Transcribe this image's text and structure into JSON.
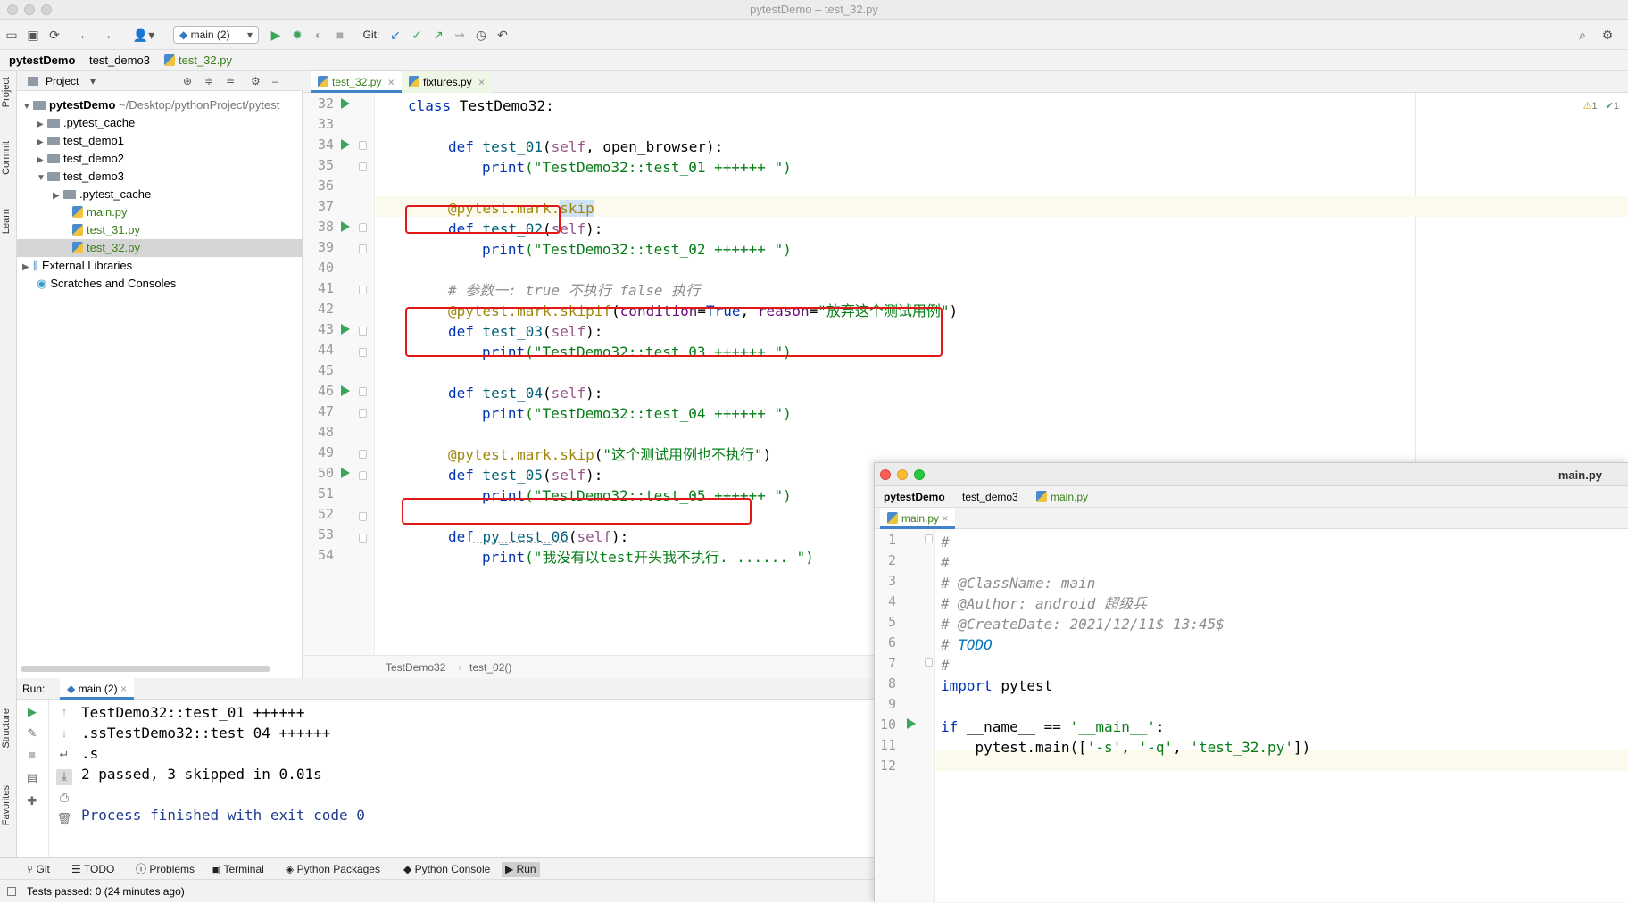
{
  "window": {
    "title": "pytestDemo – test_32.py"
  },
  "toolbar": {
    "run_config": "main (2)",
    "git_label": "Git:"
  },
  "breadcrumb": [
    "pytestDemo",
    "test_demo3",
    "test_32.py"
  ],
  "left_strip": [
    "Project",
    "Commit",
    "Learn",
    "Structure",
    "Favorites"
  ],
  "project_panel": {
    "header": "Project",
    "root_name": "pytestDemo",
    "root_path": "~/Desktop/pythonProject/pytest",
    "items": [
      {
        "label": ".pytest_cache",
        "type": "folder",
        "depth": 1
      },
      {
        "label": "test_demo1",
        "type": "folder",
        "depth": 1
      },
      {
        "label": "test_demo2",
        "type": "folder",
        "depth": 1
      },
      {
        "label": "test_demo3",
        "type": "folder",
        "depth": 1
      },
      {
        "label": ".pytest_cache",
        "type": "folder",
        "depth": 2
      },
      {
        "label": "main.py",
        "type": "py",
        "depth": 2
      },
      {
        "label": "test_31.py",
        "type": "py",
        "depth": 2
      },
      {
        "label": "test_32.py",
        "type": "py",
        "depth": 2
      },
      {
        "label": "External Libraries",
        "type": "lib",
        "depth": 0
      },
      {
        "label": "Scratches and Consoles",
        "type": "scratch",
        "depth": 0
      }
    ]
  },
  "editor": {
    "tabs": [
      "test_32.py",
      "fixtures.py"
    ],
    "inspections": {
      "warnings": "1",
      "ok": "1"
    },
    "line_numbers": [
      "32",
      "33",
      "34",
      "35",
      "36",
      "37",
      "38",
      "39",
      "40",
      "41",
      "42",
      "43",
      "44",
      "45",
      "46",
      "47",
      "48",
      "49",
      "50",
      "51",
      "52",
      "53",
      "54"
    ],
    "lines": {
      "l32_kw": "class",
      "l32_name": " TestDemo32:",
      "l34_def": "def",
      "l34_fn": " test_01",
      "l34_a": "(",
      "l34_self": "self",
      "l34_b": ", open_browser):",
      "l35_print": "print",
      "l35_str": "(\"TestDemo32::test_01 ++++++ \")",
      "l37_dec": "@pytest.mark.",
      "l37_skip": "skip",
      "l38_def": "def",
      "l38_fn": " test_02",
      "l38_a": "(",
      "l38_self": "self",
      "l38_b": "):",
      "l39_print": "print",
      "l39_str": "(\"TestDemo32::test_02 ++++++ \")",
      "l41_cmt": "# 参数一: true 不执行 false 执行",
      "l42_dec": "@pytest.mark.skipif",
      "l42_a": "(",
      "l42_p1": "condition",
      "l42_b": "=",
      "l42_true": "True",
      "l42_c": ", ",
      "l42_p2": "reason",
      "l42_d": "=",
      "l42_str": "\"放弃这个测试用例\"",
      "l42_e": ")",
      "l43_def": "def",
      "l43_fn": " test_03",
      "l43_a": "(",
      "l43_self": "self",
      "l43_b": "):",
      "l44_print": "print",
      "l44_str": "(\"TestDemo32::test_03 ++++++ \")",
      "l46_def": "def",
      "l46_fn": " test_04",
      "l46_a": "(",
      "l46_self": "self",
      "l46_b": "):",
      "l47_print": "print",
      "l47_str": "(\"TestDemo32::test_04 ++++++ \")",
      "l49_dec": "@pytest.mark.skip",
      "l49_a": "(",
      "l49_str": "\"这个测试用例也不执行\"",
      "l49_b": ")",
      "l50_def": "def",
      "l50_fn": " test_05",
      "l50_a": "(",
      "l50_self": "self",
      "l50_b": "):",
      "l51_print": "print",
      "l51_str": "(\"TestDemo32::test_05 ++++++ \")",
      "l53_def": "def",
      "l53_fn": " py_test_06",
      "l53_a": "(",
      "l53_self": "self",
      "l53_b": "):",
      "l54_print": "print",
      "l54_str": "(\"我没有以test开头我不执行. ...... \")"
    },
    "crumb": [
      "TestDemo32",
      "test_02()"
    ]
  },
  "run_panel": {
    "label": "Run:",
    "tab": "main (2)",
    "output": [
      "TestDemo32::test_01 ++++++",
      ".ssTestDemo32::test_04 ++++++",
      ".s",
      "2 passed, 3 skipped in 0.01s",
      "",
      "Process finished with exit code 0"
    ]
  },
  "bottom_tabs": [
    "Git",
    "TODO",
    "Problems",
    "Terminal",
    "Python Packages",
    "Python Console",
    "Run"
  ],
  "status": {
    "text": "Tests passed: 0 (24 minutes ago)"
  },
  "main_window": {
    "title": "main.py",
    "breadcrumb": [
      "pytestDemo",
      "test_demo3",
      "main.py"
    ],
    "tab": "main.py",
    "line_numbers": [
      "1",
      "2",
      "3",
      "4",
      "5",
      "6",
      "7",
      "8",
      "9",
      "10",
      "11",
      "12"
    ],
    "lines": {
      "l1": "#",
      "l2": "#",
      "l3": "# @ClassName: main",
      "l4": "# @Author: android 超级兵",
      "l5": "# @CreateDate: 2021/12/11$ 13:45$",
      "l6_hash": "# ",
      "l6_todo": "TODO",
      "l7": "#",
      "l8_kw": "import",
      "l8_b": " pytest",
      "l10_kw": "if",
      "l10_a": " __name__ == ",
      "l10_str": "'__main__'",
      "l10_b": ":",
      "l11_a": "    pytest.main([",
      "l11_s1": "'-s'",
      "l11_c1": ", ",
      "l11_s2": "'-q'",
      "l11_c2": ", ",
      "l11_s3": "'test_32.py'",
      "l11_b": "])"
    }
  }
}
